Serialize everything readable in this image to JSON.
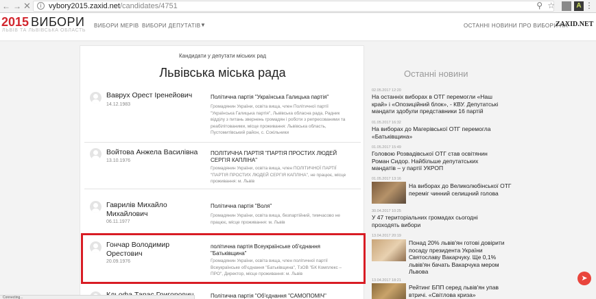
{
  "browser": {
    "url_host": "vybory2015.zaxid.net",
    "url_path": "/candidates/4751",
    "ext_label": "A"
  },
  "header": {
    "logo_year": "2015",
    "logo_word": "ВИБОРИ",
    "logo_sub": "ЛЬВІВ ТА ЛЬВІВСЬКА ОБЛАСТЬ",
    "nav": [
      "ВИБОРИ МЕРІВ",
      "ВИБОРИ ДЕПУТАТІВ"
    ],
    "news_link": "ОСТАННІ НОВИНИ ПРО ВИБОРИ НА",
    "brand": "ZAXID.NET"
  },
  "card": {
    "subtitle": "Кандидати у депутати міських рад",
    "title": "Львівська міська рада",
    "candidates": [
      {
        "name": "Ваврух Орест Іренейович",
        "date": "14.12.1983",
        "party": "Політична партія \"Українська Галицька партія\"",
        "desc": "Громадянин України, освіта вища, член Політичної партії \"Українська Галицька партія\", Львівська обласна рада, Радник відділу з питань звернень громадян і роботи з репресованими та реабілітованими, місце проживання: Львівська область, Пустомитівський район, с. Сокільники"
      },
      {
        "name": "Войтова Анжела Василівна",
        "date": "13.10.1976",
        "party": "ПОЛІТИЧНА ПАРТІЯ \"ПАРТІЯ ПРОСТИХ ЛЮДЕЙ СЕРГІЯ КАПЛІНА\"",
        "desc": "Громадянин України, освіта вища, член ПОЛІТИЧНОЇ ПАРТІЇ \"ПАРТІЯ ПРОСТИХ ЛЮДЕЙ СЕРГІЯ КАПЛІНА\", не працює, місце проживання: м. Львів"
      },
      {
        "name": "Гаврилів Михайло Михайлович",
        "date": "06.11.1977",
        "party": "Політична партія \"Воля\"",
        "desc": "Громадянин України, освіта вища, безпартійний, тимчасово не працює, місце проживання: м. Львів"
      },
      {
        "name": "Гончар Володимир Орестович",
        "date": "20.09.1976",
        "party": "політична партія Всеукраїнське об'єднання \"Батьківщина\"",
        "desc": "Громадянин України, освіта вища, член політичної партії Всеукраїнське об'єднання \"Батьківщина\", ТзОВ \"БК Комплекс – ПРО\", Директор, місце проживання: м. Львів"
      },
      {
        "name": "Кльофа Тарас Григорович",
        "date": "",
        "party": "Політична партія \"Об'єднання \"САМОПОМІЧ\"",
        "desc": ""
      }
    ]
  },
  "sidebar": {
    "title": "Останні новини",
    "items": [
      {
        "date": "02.05.2017 12:20",
        "text": "На останніх виборах в ОТГ перемогли «Наш край» і «Опозиційний блок», - КВУ. Депутатські мандати здобули представники 16 партій",
        "img": ""
      },
      {
        "date": "01.05.2017 16:32",
        "text": "На виборах до Магерівської ОТГ перемогла «Батьківщина»",
        "img": ""
      },
      {
        "date": "01.05.2017 15:49",
        "text": "Головою Розвадівської ОТГ став освітянин Роман Сидор. Найбільше депутатських мандатів – у партії УКРОП",
        "img": ""
      },
      {
        "date": "01.05.2017 13:16",
        "text": "На виборах до Великолюбінської ОТГ переміг чинний селищний голова",
        "img": "person"
      },
      {
        "date": "30.04.2017 10:25",
        "text": "У 47 територіальних громадах сьогодні проходять вибори",
        "img": ""
      },
      {
        "date": "13.04.2017 20:19",
        "text": "Понад 20% львів'ян готові довірити посаду президента України Святославу Вакарчуку. Ще 0,1% львів'ян бачать Вакарчука мером Львова",
        "img": "sand"
      },
      {
        "date": "13.04.2017 18:21",
        "text": "Рейтинг БПП серед львів'ян упав втричі. «Світлова криза»",
        "img": "hall"
      }
    ]
  },
  "status_bar": "Connecting..."
}
